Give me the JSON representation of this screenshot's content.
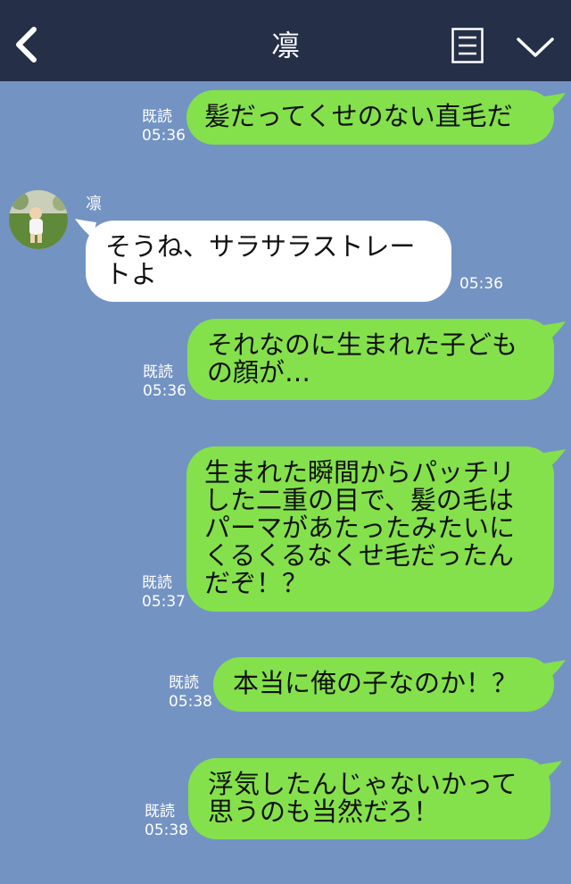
{
  "header": {
    "title": "凛",
    "back_icon": "chevron-left-icon",
    "menu_icon": "list-icon",
    "more_icon": "chevron-down-icon",
    "bg_color": "#252f48"
  },
  "chat": {
    "bg_color": "#7393c3",
    "outgoing_color": "#84e14b",
    "incoming_color": "#ffffff",
    "messages": [
      {
        "dir": "out",
        "text": "髪だってくせのない直毛だ",
        "read": "既読",
        "time": "05:36"
      },
      {
        "dir": "in",
        "sender": "凛",
        "text": "そうね、サラサラストレートよ",
        "time": "05:36"
      },
      {
        "dir": "out",
        "text": "それなのに生まれた子どもの顔が…",
        "read": "既読",
        "time": "05:36"
      },
      {
        "dir": "out",
        "text": "生まれた瞬間からパッチリした二重の目で、髪の毛はパーマがあたったみたいにくるくるなくせ毛だったんだぞ！？",
        "read": "既読",
        "time": "05:37"
      },
      {
        "dir": "out",
        "text": "本当に俺の子なのか！？",
        "read": "既読",
        "time": "05:38"
      },
      {
        "dir": "out",
        "text": "浮気したんじゃないかって思うのも当然だろ！",
        "read": "既読",
        "time": "05:38"
      }
    ]
  }
}
